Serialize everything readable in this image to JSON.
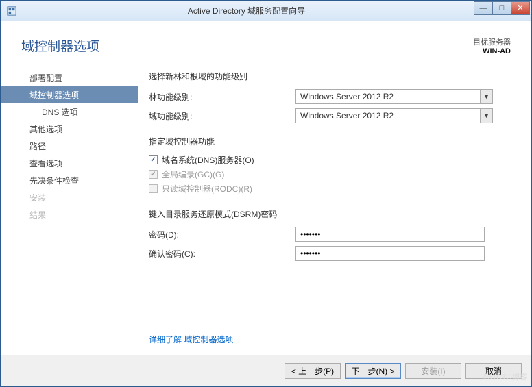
{
  "window": {
    "title": "Active Directory 域服务配置向导"
  },
  "header": {
    "page_title": "域控制器选项",
    "target_label": "目标服务器",
    "target_name": "WIN-AD"
  },
  "sidebar": {
    "items": [
      {
        "label": "部署配置"
      },
      {
        "label": "域控制器选项"
      },
      {
        "label": "DNS 选项"
      },
      {
        "label": "其他选项"
      },
      {
        "label": "路径"
      },
      {
        "label": "查看选项"
      },
      {
        "label": "先决条件检查"
      },
      {
        "label": "安装"
      },
      {
        "label": "结果"
      }
    ]
  },
  "main": {
    "func_label": "选择新林和根域的功能级别",
    "forest_level_label": "林功能级别:",
    "forest_level_value": "Windows Server 2012 R2",
    "domain_level_label": "域功能级别:",
    "domain_level_value": "Windows Server 2012 R2",
    "cap_label": "指定域控制器功能",
    "cb_dns": "域名系统(DNS)服务器(O)",
    "cb_gc": "全局编录(GC)(G)",
    "cb_rodc": "只读域控制器(RODC)(R)",
    "dsrm_label": "键入目录服务还原模式(DSRM)密码",
    "pwd_label": "密码(D):",
    "pwd_value": "•••••••",
    "pwd2_label": "确认密码(C):",
    "pwd2_value": "•••••••",
    "more_link": "详细了解 域控制器选项"
  },
  "footer": {
    "prev": "< 上一步(P)",
    "next": "下一步(N) >",
    "install": "安装(I)",
    "cancel": "取消"
  },
  "watermark": "©51CTO博客"
}
